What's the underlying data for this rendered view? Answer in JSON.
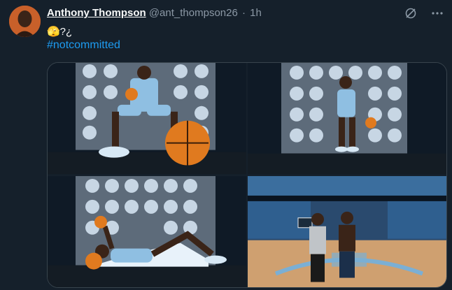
{
  "tweet": {
    "author_name": "Anthony Thompson",
    "handle": "@ant_thompson26",
    "separator": "·",
    "time": "1h",
    "body_text": "🫣?¿",
    "hashtag": "#notcommitted"
  },
  "photos": [
    {
      "alt": "player-seated-with-basketball"
    },
    {
      "alt": "player-dribbling"
    },
    {
      "alt": "player-lying-with-basketball"
    },
    {
      "alt": "players-on-court"
    }
  ],
  "colors": {
    "background": "#15202b",
    "link": "#1d9bf0",
    "muted": "#8b98a5",
    "carolina_blue": "#7bafd4"
  },
  "icons": {
    "grok": "grok-icon",
    "more": "more-icon"
  }
}
